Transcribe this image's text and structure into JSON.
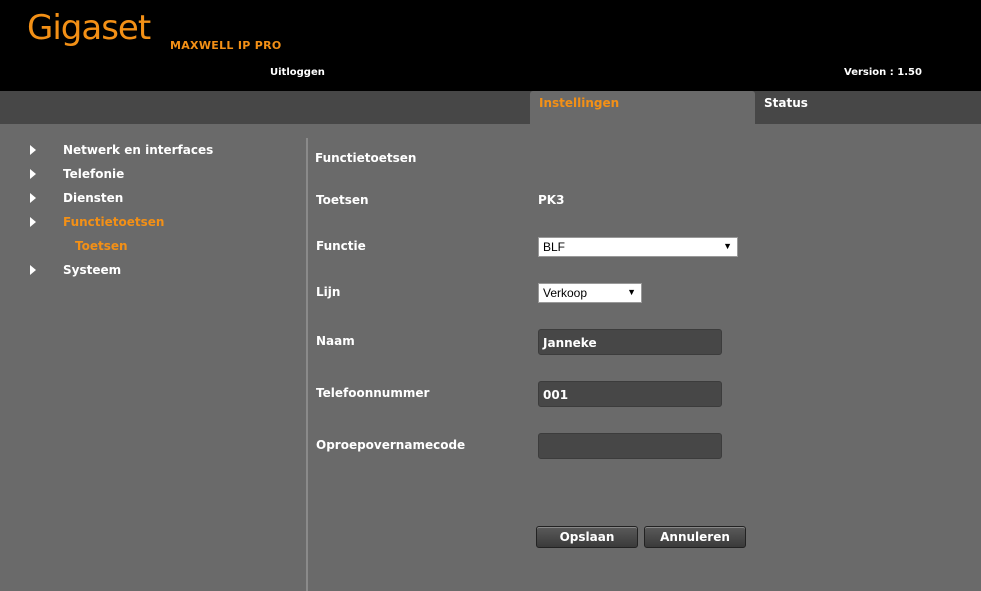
{
  "header": {
    "logo": "Gigaset",
    "product": "MAXWELL IP PRO",
    "logout": "Uitloggen",
    "version": "Version : 1.50"
  },
  "tabs": {
    "settings": "Instellingen",
    "status": "Status"
  },
  "sidebar": {
    "items": [
      {
        "label": "Netwerk en interfaces"
      },
      {
        "label": "Telefonie"
      },
      {
        "label": "Diensten"
      },
      {
        "label": "Functietoetsen"
      },
      {
        "label": "Systeem"
      }
    ],
    "sub_item": "Toetsen"
  },
  "form": {
    "title": "Functietoetsen",
    "keys_label": "Toetsen",
    "keys_value": "PK3",
    "function_label": "Functie",
    "function_value": "BLF",
    "line_label": "Lijn",
    "line_value": "Verkoop",
    "name_label": "Naam",
    "name_value": "Janneke",
    "phone_label": "Telefoonnummer",
    "phone_value": "001",
    "pickup_label": "Oproepovernamecode",
    "pickup_value": ""
  },
  "buttons": {
    "save": "Opslaan",
    "cancel": "Annuleren"
  },
  "colors": {
    "accent": "#f39016",
    "panel": "#6a6a6a",
    "tabbar": "#474747"
  }
}
